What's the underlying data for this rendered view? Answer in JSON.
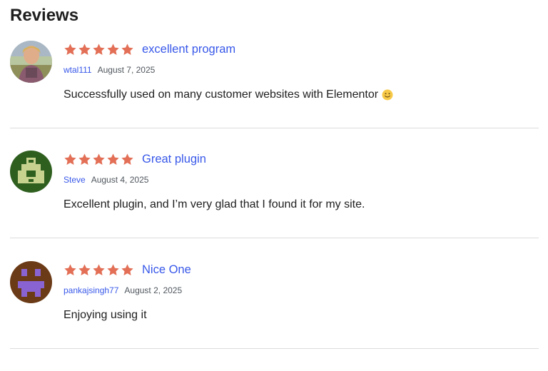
{
  "section": {
    "title": "Reviews"
  },
  "colors": {
    "star": "#e26f56",
    "link": "#3858e9",
    "divider": "#dcdcde"
  },
  "reviews": [
    {
      "title": "excellent program",
      "author": "wtal111",
      "date": "August 7, 2025",
      "text": "Successfully used on many customer websites with Elementor",
      "rating": 5,
      "avatar": "photo-avatar",
      "emoji": "slightly-smiling-face-icon"
    },
    {
      "title": "Great plugin",
      "author": "Steve",
      "date": "August 4, 2025",
      "text": "Excellent plugin, and I’m very glad that I found it for my site.",
      "rating": 5,
      "avatar": "identicon-green-avatar"
    },
    {
      "title": "Nice One",
      "author": "pankajsingh77",
      "date": "August 2, 2025",
      "text": "Enjoying using it",
      "rating": 5,
      "avatar": "identicon-purple-avatar"
    }
  ]
}
